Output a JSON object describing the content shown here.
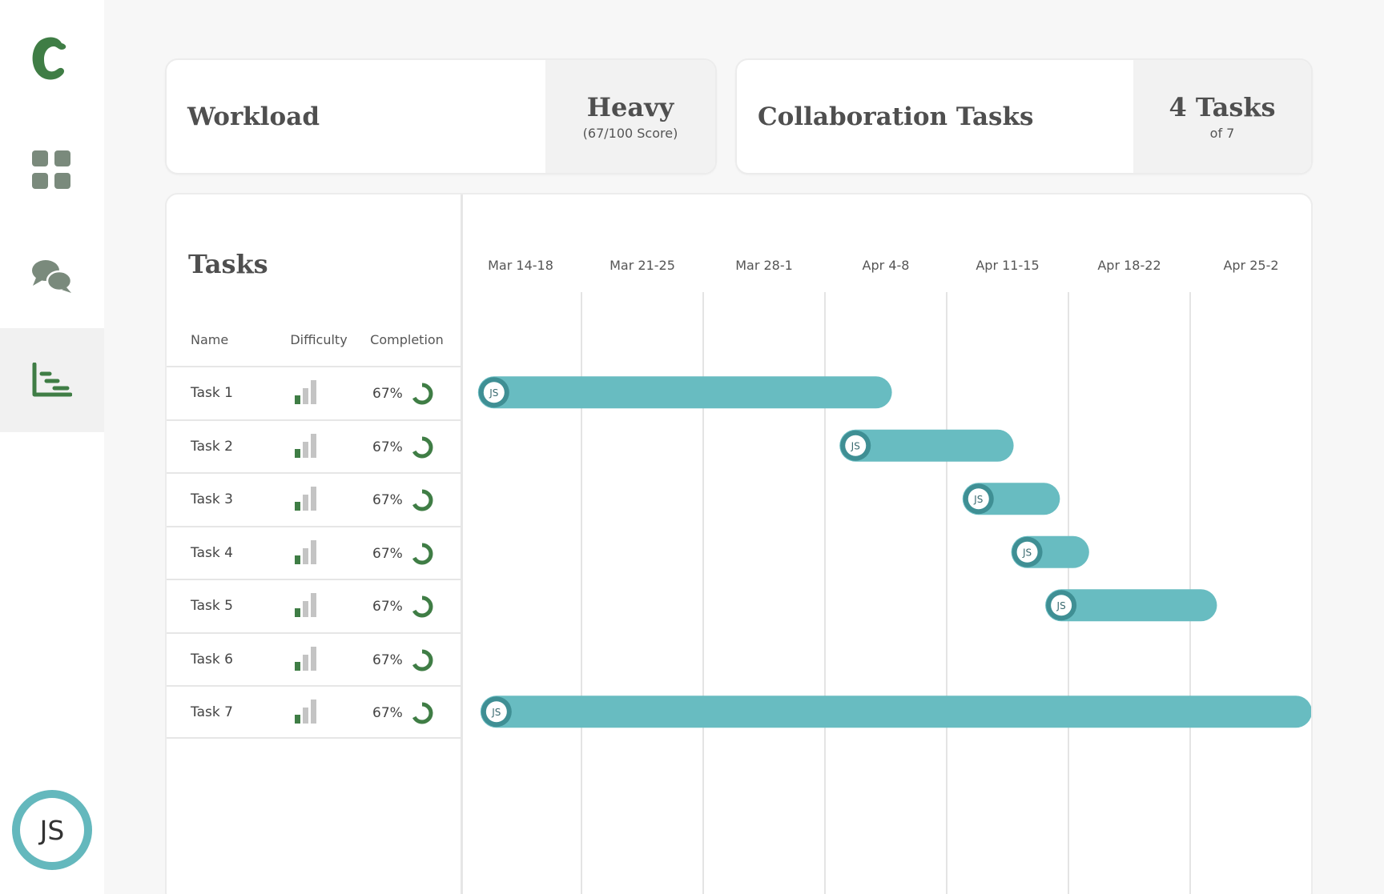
{
  "brand": {
    "logo_letter": "c",
    "accent": "#3f7d45"
  },
  "sidebar": {
    "items": [
      {
        "name": "dashboard",
        "icon": "grid-icon",
        "active": false
      },
      {
        "name": "chat",
        "icon": "chat-bubbles-icon",
        "active": false
      },
      {
        "name": "chart",
        "icon": "gantt-chart-icon",
        "active": true
      }
    ],
    "user_initials": "JS"
  },
  "workload_card": {
    "title": "Workload",
    "value": "Heavy",
    "detail": "(67/100 Score)"
  },
  "collab_card": {
    "title": "Collaboration Tasks",
    "value": "4 Tasks",
    "detail": "of 7"
  },
  "tasks": {
    "title": "Tasks",
    "columns": {
      "name": "Name",
      "difficulty": "Difficulty",
      "completion": "Completion"
    },
    "rows": [
      {
        "name": "Task 1",
        "difficulty_level": 1,
        "completion": "67%",
        "completion_value": 0.67
      },
      {
        "name": "Task 2",
        "difficulty_level": 1,
        "completion": "67%",
        "completion_value": 0.67
      },
      {
        "name": "Task 3",
        "difficulty_level": 1,
        "completion": "67%",
        "completion_value": 0.67
      },
      {
        "name": "Task 4",
        "difficulty_level": 1,
        "completion": "67%",
        "completion_value": 0.67
      },
      {
        "name": "Task 5",
        "difficulty_level": 1,
        "completion": "67%",
        "completion_value": 0.67
      },
      {
        "name": "Task 6",
        "difficulty_level": 1,
        "completion": "67%",
        "completion_value": 0.67
      },
      {
        "name": "Task 7",
        "difficulty_level": 1,
        "completion": "67%",
        "completion_value": 0.67
      }
    ]
  },
  "colors": {
    "bar": "#68bcc1",
    "bar_dark": "#3f8f94",
    "accent_green": "#3f7d45",
    "bar_gray": "#c4c4c4"
  },
  "chart_data": {
    "type": "gantt",
    "weeks": [
      "Mar 14-18",
      "Mar 21-25",
      "Mar 28-1",
      "Apr 4-8",
      "Apr 11-15",
      "Apr 18-22",
      "Apr 25-2"
    ],
    "series": [
      {
        "task": "Task 1",
        "assignee": "JS",
        "start_week": 0.15,
        "end_week": 3.55
      },
      {
        "task": "Task 2",
        "assignee": "JS",
        "start_week": 3.12,
        "end_week": 4.55
      },
      {
        "task": "Task 3",
        "assignee": "JS",
        "start_week": 4.13,
        "end_week": 4.93
      },
      {
        "task": "Task 4",
        "assignee": "JS",
        "start_week": 4.53,
        "end_week": 5.17
      },
      {
        "task": "Task 5",
        "assignee": "JS",
        "start_week": 4.81,
        "end_week": 6.22
      },
      {
        "task": "Task 7",
        "assignee": "JS",
        "start_week": 0.17,
        "end_week": 7.0
      }
    ]
  }
}
